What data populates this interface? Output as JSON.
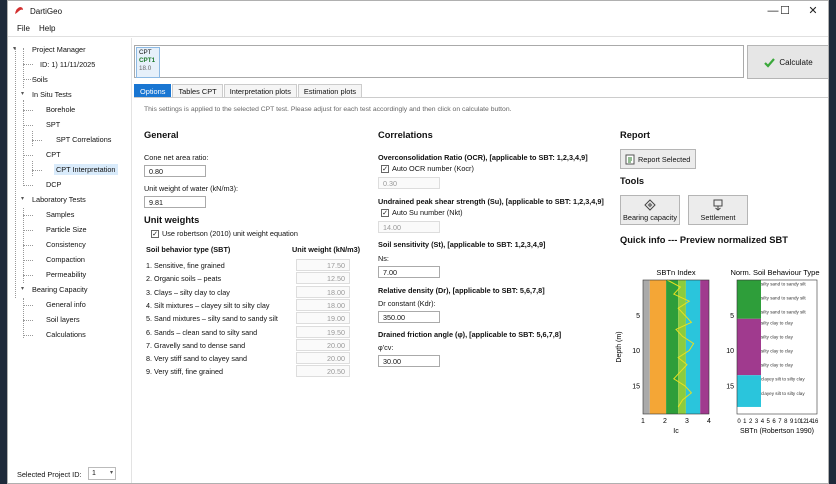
{
  "app": {
    "title": "DartiGeo",
    "window_buttons": [
      "—",
      "☐",
      "✕"
    ]
  },
  "menu": [
    "File",
    "Help"
  ],
  "tree": {
    "project_manager": "Project Manager",
    "project_id": "ID: 1) 11/11/2025",
    "soils": "Soils",
    "in_situ": "In Situ Tests",
    "borehole": "Borehole",
    "spt": "SPT",
    "spt_corr": "SPT Correlations",
    "cpt": "CPT",
    "cpt_interp": "CPT Interpretation",
    "dcp": "DCP",
    "lab": "Laboratory Tests",
    "samples": "Samples",
    "particle": "Particle Size",
    "consistency": "Consistency",
    "compaction": "Compaction",
    "permeability": "Permeability",
    "bearing": "Bearing Capacity",
    "general_info": "General info",
    "soil_layers": "Soil layers",
    "calculations": "Calculations"
  },
  "selected_project": {
    "label": "Selected Project ID:",
    "value": "1"
  },
  "cpt_card": {
    "l1": "CPT",
    "l2": "CPT1",
    "l3": "18.0"
  },
  "calculate": "Calculate",
  "tabs": [
    "Options",
    "Tables CPT",
    "Interpretation plots",
    "Estimation plots"
  ],
  "info": "This settings is applied to the selected CPT test. Please adjust for each test accordingly and then click on calculate button.",
  "general": {
    "heading": "General",
    "cone_label": "Cone net area ratio:",
    "cone_value": "0.80",
    "water_label": "Unit weight of water (kN/m3):",
    "water_value": "9.81"
  },
  "unit_weights": {
    "heading": "Unit weights",
    "use_robertson": "Use robertson (2010) unit weight equation",
    "col_sbt": "Soil behavior type (SBT)",
    "col_uw": "Unit weight (kN/m3)",
    "rows": [
      {
        "name": "1. Sensitive, fine grained",
        "value": "17.50"
      },
      {
        "name": "2. Organic soils – peats",
        "value": "12.50"
      },
      {
        "name": "3. Clays – silty clay to clay",
        "value": "18.00"
      },
      {
        "name": "4. Silt mixtures – clayey silt to silty clay",
        "value": "18.00"
      },
      {
        "name": "5. Sand mixtures – silty sand to sandy silt",
        "value": "19.00"
      },
      {
        "name": "6. Sands – clean sand to silty sand",
        "value": "19.50"
      },
      {
        "name": "7. Gravelly sand to dense sand",
        "value": "20.00"
      },
      {
        "name": "8. Very stiff sand to clayey sand",
        "value": "20.00"
      },
      {
        "name": "9. Very stiff, fine grained",
        "value": "20.50"
      }
    ]
  },
  "correlations": {
    "heading": "Correlations",
    "ocr_title": "Overconsolidation Ratio (OCR), [applicable to SBT: 1,2,3,4,9]",
    "ocr_auto": "Auto OCR number (Kocr)",
    "ocr_value": "0.30",
    "su_title": "Undrained peak shear strength (Su), [applicable to SBT: 1,2,3,4,9]",
    "su_auto": "Auto Su number (Nkt)",
    "su_value": "14.00",
    "st_title": "Soil sensitivity (St), [applicable to SBT: 1,2,3,4,9]",
    "ns_label": "Ns:",
    "ns_value": "7.00",
    "dr_title": "Relative density (Dr), [applicable to SBT: 5,6,7,8]",
    "kdr_label": "Dr constant (Kdr):",
    "kdr_value": "350.00",
    "phi_title": "Drained friction angle (φ), [applicable to SBT: 5,6,7,8]",
    "phi_label": "φ'cv:",
    "phi_value": "30.00"
  },
  "report": {
    "heading": "Report",
    "button": "Report Selected"
  },
  "tools": {
    "heading": "Tools",
    "bearing": "Bearing capacity",
    "settlement": "Settlement"
  },
  "quick_info": {
    "heading": "Quick info --- Preview normalized SBT"
  },
  "chart_data": [
    {
      "type": "area",
      "title": "SBTn Index",
      "ylabel": "Depth (m)",
      "xlabel": "Ic",
      "xticks": [
        "1",
        "2",
        "3",
        "4"
      ],
      "yticks": [
        "5",
        "10",
        "15"
      ],
      "xlim": [
        1,
        4
      ],
      "ylim": [
        0,
        19
      ],
      "zones": [
        {
          "from": 1.0,
          "to": 1.31,
          "color": "#aaaaaa"
        },
        {
          "from": 1.31,
          "to": 2.05,
          "color": "#f4a636"
        },
        {
          "from": 2.05,
          "to": 2.6,
          "color": "#2e9e3a"
        },
        {
          "from": 2.6,
          "to": 2.95,
          "color": "#8ccc3e"
        },
        {
          "from": 2.95,
          "to": 3.6,
          "color": "#2ac5dc"
        },
        {
          "from": 3.6,
          "to": 4.0,
          "color": "#a03a8e"
        }
      ],
      "series": [
        {
          "x": [
            2.1,
            2.7,
            2.4,
            3.1,
            2.6,
            2.9,
            3.2,
            2.5,
            2.8,
            3.3,
            3.1,
            2.6,
            3.0,
            2.7,
            2.4,
            2.9,
            3.2,
            2.8,
            2.6
          ],
          "y": [
            0,
            1,
            2,
            3,
            4,
            5,
            6,
            7,
            8,
            9,
            10,
            11,
            12,
            13,
            14,
            15,
            16,
            17,
            18
          ]
        }
      ]
    },
    {
      "type": "bar",
      "title": "Norm. Soil Behaviour Type",
      "xlabel": "SBTn (Robertson 1990)",
      "xticks": [
        "0",
        "1",
        "2",
        "3",
        "4",
        "5",
        "6",
        "7",
        "8",
        "9",
        "10",
        "12",
        "14",
        "16"
      ],
      "yticks": [
        "5",
        "10",
        "15"
      ],
      "ylim": [
        0,
        19
      ],
      "layers": [
        {
          "top": 0,
          "bottom": 5.5,
          "color": "#2e9e3a",
          "label": "silty sand to sandy silt"
        },
        {
          "top": 5.5,
          "bottom": 13.5,
          "color": "#a03a8e",
          "label": "silty clay to clay"
        },
        {
          "top": 13.5,
          "bottom": 18,
          "color": "#2ac5dc",
          "label": "clayey silt to silty clay"
        }
      ],
      "annotations": [
        "silty sand to sandy silt",
        "silty clay to clay",
        "clayey silt to silty clay"
      ]
    }
  ]
}
